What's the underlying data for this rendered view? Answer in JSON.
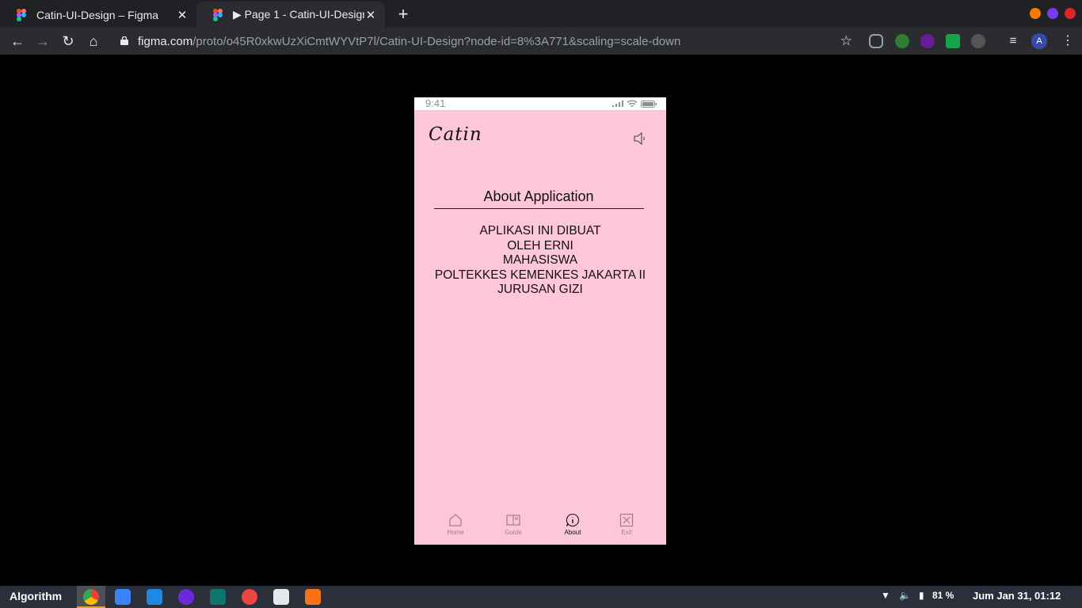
{
  "browser": {
    "tabs": [
      {
        "label": "Catin-UI-Design – Figma",
        "active": false
      },
      {
        "label": "▶ Page 1 - Catin-UI-Design",
        "active": true
      }
    ],
    "url_host": "figma.com",
    "url_path": "/proto/o45R0xkwUzXiCmtWYVtP7l/Catin-UI-Design?node-id=8%3A771&scaling=scale-down",
    "avatar_letter": "A",
    "window_dots": [
      "#f57c00",
      "#7c3aed",
      "#dc2626"
    ]
  },
  "phone": {
    "status_time": "9:41",
    "brand": "Catin",
    "page_title": "About Application",
    "lines": [
      "APLIKASI INI DIBUAT",
      "OLEH ERNI",
      "MAHASISWA",
      "POLTEKKES KEMENKES JAKARTA II",
      "JURUSAN GIZI"
    ],
    "nav": [
      {
        "label": "Home",
        "icon": "home-icon",
        "active": false
      },
      {
        "label": "Guide",
        "icon": "book-icon",
        "active": false
      },
      {
        "label": "About",
        "icon": "info-icon",
        "active": true
      },
      {
        "label": "Exit",
        "icon": "exit-icon",
        "active": false
      }
    ],
    "background": "#fec6da"
  },
  "taskbar": {
    "workspace": "Algorithm",
    "battery": "81 %",
    "clock": "Jum Jan 31, 01:12"
  }
}
